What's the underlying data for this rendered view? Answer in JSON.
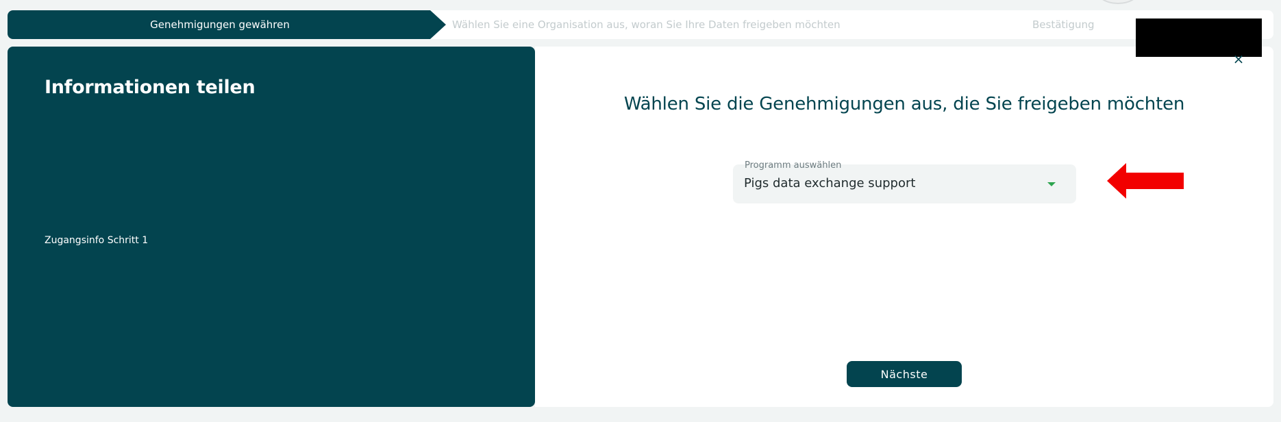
{
  "stepper": {
    "steps": [
      {
        "label": "Genehmigungen gewähren",
        "active": true
      },
      {
        "label": "Wählen Sie eine Organisation aus, woran Sie Ihre Daten freigeben möchten",
        "active": false
      },
      {
        "label": "Bestätigung",
        "active": false
      }
    ]
  },
  "left_panel": {
    "title": "Informationen teilen",
    "subtitle": "Zugangsinfo Schritt 1"
  },
  "right_panel": {
    "title": "Wählen Sie die Genehmigungen aus, die Sie freigeben möchten",
    "close_icon": "close-icon",
    "close_glyph": "×",
    "select": {
      "label": "Programm auswählen",
      "value": "Pigs data exchange support"
    },
    "next_label": "Nächste"
  },
  "colors": {
    "primary": "#03444f",
    "background": "#f1f4f4",
    "caret": "#2da44e",
    "annotation_arrow": "#f20000",
    "inactive_step": "#c3cbcd"
  }
}
